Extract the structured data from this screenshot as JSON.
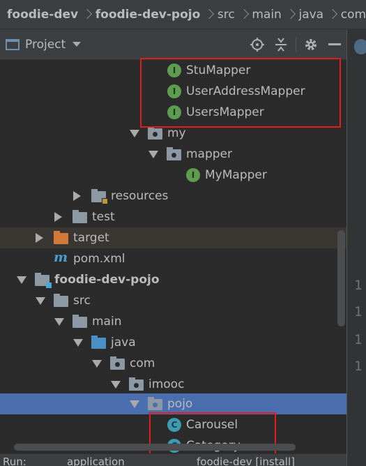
{
  "breadcrumb": [
    "foodie-dev",
    "foodie-dev-pojo",
    "src",
    "main",
    "java",
    "com"
  ],
  "toolwindow": {
    "title": "Project"
  },
  "editor_gutter": [
    "1",
    "1",
    "1",
    "1"
  ],
  "tree": [
    {
      "label": "StuMapper",
      "icon": "interface-icon"
    },
    {
      "label": "UserAddressMapper",
      "icon": "interface-icon"
    },
    {
      "label": "UsersMapper",
      "icon": "interface-icon"
    },
    {
      "label": "my",
      "icon": "package-folder-icon"
    },
    {
      "label": "mapper",
      "icon": "package-folder-icon"
    },
    {
      "label": "MyMapper",
      "icon": "interface-icon"
    },
    {
      "label": "resources",
      "icon": "resources-folder-icon"
    },
    {
      "label": "test",
      "icon": "folder-icon"
    },
    {
      "label": "target",
      "icon": "excluded-folder-icon"
    },
    {
      "label": "pom.xml",
      "icon": "maven-icon"
    },
    {
      "label": "foodie-dev-pojo",
      "icon": "module-folder-icon"
    },
    {
      "label": "src",
      "icon": "folder-icon"
    },
    {
      "label": "main",
      "icon": "folder-icon"
    },
    {
      "label": "java",
      "icon": "source-folder-icon"
    },
    {
      "label": "com",
      "icon": "package-folder-icon"
    },
    {
      "label": "imooc",
      "icon": "package-folder-icon"
    },
    {
      "label": "pojo",
      "icon": "package-folder-icon"
    },
    {
      "label": "Carousel",
      "icon": "class-icon"
    },
    {
      "label": "Category",
      "icon": "class-icon"
    }
  ],
  "bottombar": {
    "run_label": "Run:",
    "config1": "application",
    "config2": "foodie-dev [install]"
  },
  "colors": {
    "selection": "#4b6eaf",
    "highlight_box": "#e11d1d",
    "interface": "#5e9c4f",
    "class": "#3d9cb3"
  }
}
